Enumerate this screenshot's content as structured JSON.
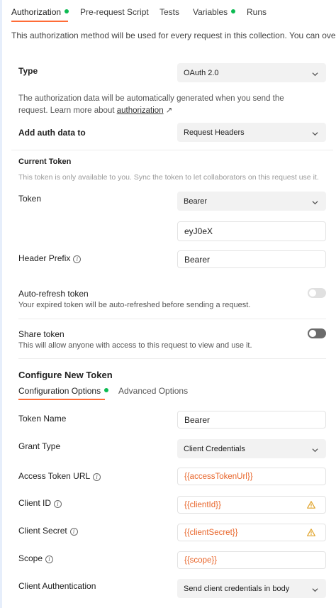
{
  "tabs": [
    {
      "label": "Authorization",
      "dot": true
    },
    {
      "label": "Pre-request Script",
      "dot": false
    },
    {
      "label": "Tests",
      "dot": false
    },
    {
      "label": "Variables",
      "dot": true
    },
    {
      "label": "Runs",
      "dot": false
    }
  ],
  "notice": "This authorization method will be used for every request in this collection. You can override this",
  "type": {
    "label": "Type",
    "value": "OAuth 2.0"
  },
  "auth_desc": {
    "line1": "The authorization data will be automatically generated when you send the",
    "line2_prefix": "request. Learn more about ",
    "link": "authorization",
    "arrow": "↗"
  },
  "add_auth": {
    "label": "Add auth data to",
    "value": "Request Headers"
  },
  "current_token": {
    "title": "Current Token",
    "hint": "This token is only available to you. Sync the token to let collaborators on this request use it.",
    "token_label": "Token",
    "token_type": "Bearer",
    "token_value": "eyJ0eX",
    "header_prefix_label": "Header Prefix",
    "header_prefix_value": "Bearer"
  },
  "auto_refresh": {
    "label": "Auto-refresh token",
    "desc": "Your expired token will be auto-refreshed before sending a request.",
    "enabled": false
  },
  "share_token": {
    "label": "Share token",
    "desc": "This will allow anyone with access to this request to view and use it.",
    "enabled": true
  },
  "configure": {
    "title": "Configure New Token",
    "tabs": [
      {
        "label": "Configuration Options",
        "dot": true
      },
      {
        "label": "Advanced Options",
        "dot": false
      }
    ]
  },
  "fields": {
    "token_name": {
      "label": "Token Name",
      "value": "Bearer"
    },
    "grant_type": {
      "label": "Grant Type",
      "value": "Client Credentials"
    },
    "access_token_url": {
      "label": "Access Token URL",
      "value": "{{accessTokenUrl}}"
    },
    "client_id": {
      "label": "Client ID",
      "value": "{{clientId}}"
    },
    "client_secret": {
      "label": "Client Secret",
      "value": "{{clientSecret}}"
    },
    "scope": {
      "label": "Scope",
      "value": "{{scope}}"
    },
    "client_auth": {
      "label": "Client Authentication",
      "value": "Send client credentials in body"
    }
  },
  "icons": {
    "info": "info-icon",
    "chevron": "chevron-down-icon",
    "warning": "warning-icon",
    "external": "external-link-icon"
  },
  "colors": {
    "accent": "#ff6c37",
    "status_dot": "#0cbb52",
    "variable_text": "#e8652a",
    "warning": "#e0a32a"
  }
}
